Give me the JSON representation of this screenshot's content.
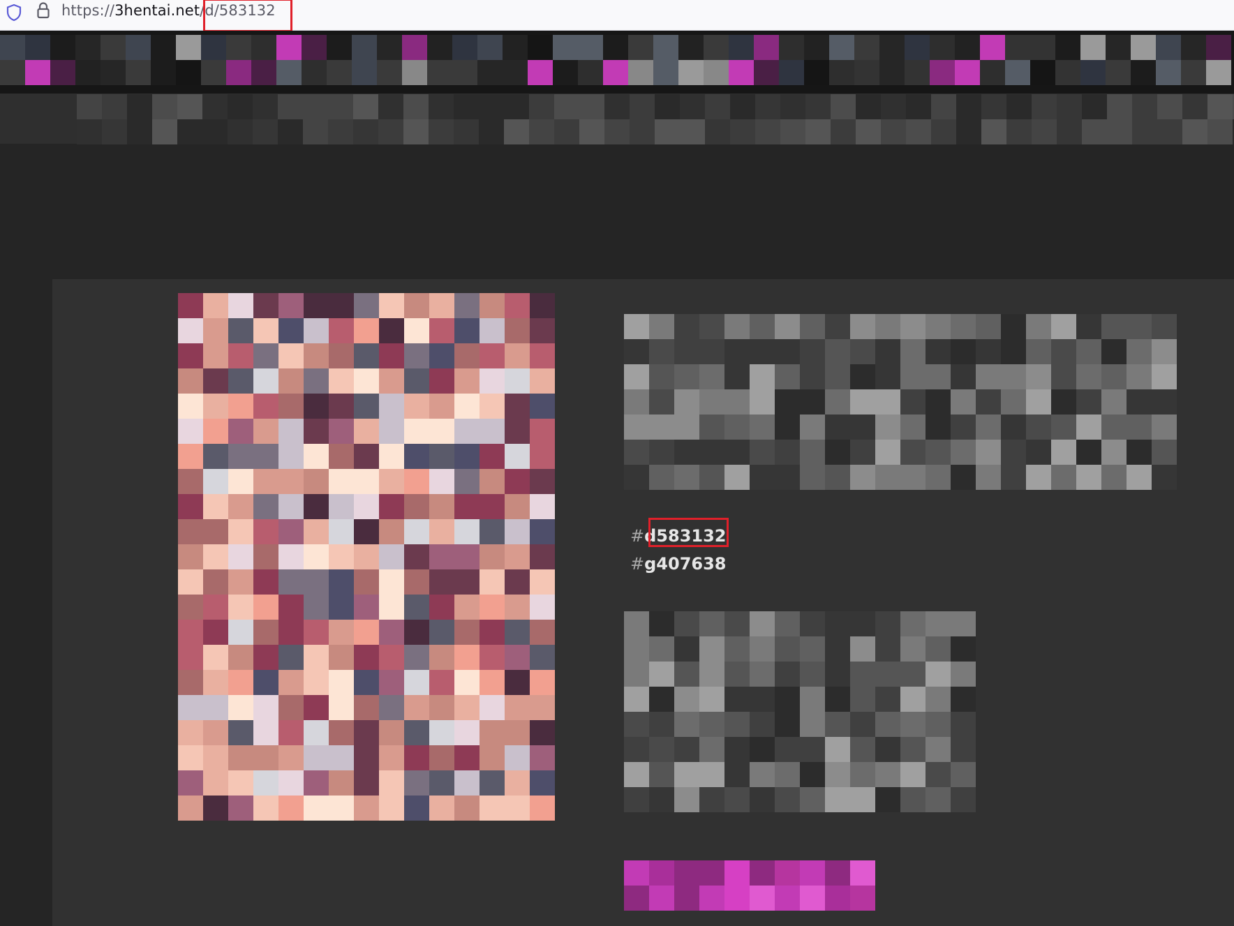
{
  "browser": {
    "url_prefix": "https://",
    "url_domain": "3hentai.net",
    "url_path": "/d/583132"
  },
  "gallery": {
    "tags": [
      {
        "hash": "#",
        "label": "d583132"
      },
      {
        "hash": "#",
        "label": "g407638"
      }
    ]
  },
  "colors": {
    "accent": "#d33ab8",
    "highlight_box": "#e0202a",
    "page_background": "#252525",
    "card_background": "#313131"
  }
}
